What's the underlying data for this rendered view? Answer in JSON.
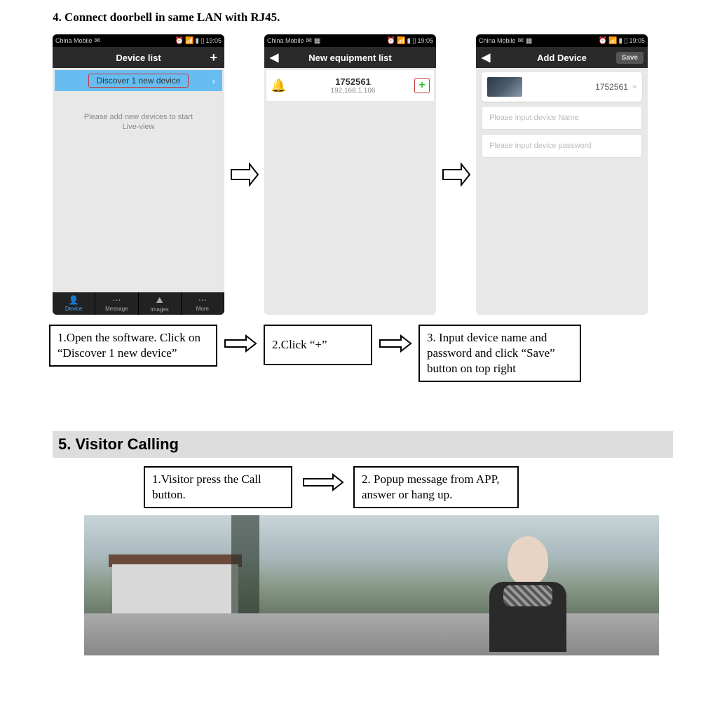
{
  "section4": {
    "heading": "4.  Connect doorbell in same LAN with RJ45.",
    "phones": {
      "statusbar": {
        "carrier": "China Mobile",
        "time": "19:05"
      },
      "p1": {
        "title": "Device list",
        "discover": "Discover  1  new device",
        "placeholder_l1": "Please add new devices to start",
        "placeholder_l2": "Live-view",
        "nav": {
          "device": "Device",
          "message": "Message",
          "images": "Images",
          "more": "More"
        }
      },
      "p2": {
        "title": "New equipment list",
        "item_id": "1752561",
        "item_ip": "192.168.1.106"
      },
      "p3": {
        "title": "Add Device",
        "save": "Save",
        "preview_id": "1752561",
        "name_placeholder": "Please input device Name",
        "password_placeholder": "Please input device password"
      }
    },
    "captions": {
      "c1": "1.Open the software. Click on “Discover 1 new device”",
      "c2": "2.Click “+”",
      "c3": "3. Input device name and password and click “Save” button on top right"
    }
  },
  "section5": {
    "heading": "5. Visitor Calling",
    "captions": {
      "c1": "1.Visitor press the Call button.",
      "c2": "2. Popup message from APP, answer or hang up."
    }
  }
}
